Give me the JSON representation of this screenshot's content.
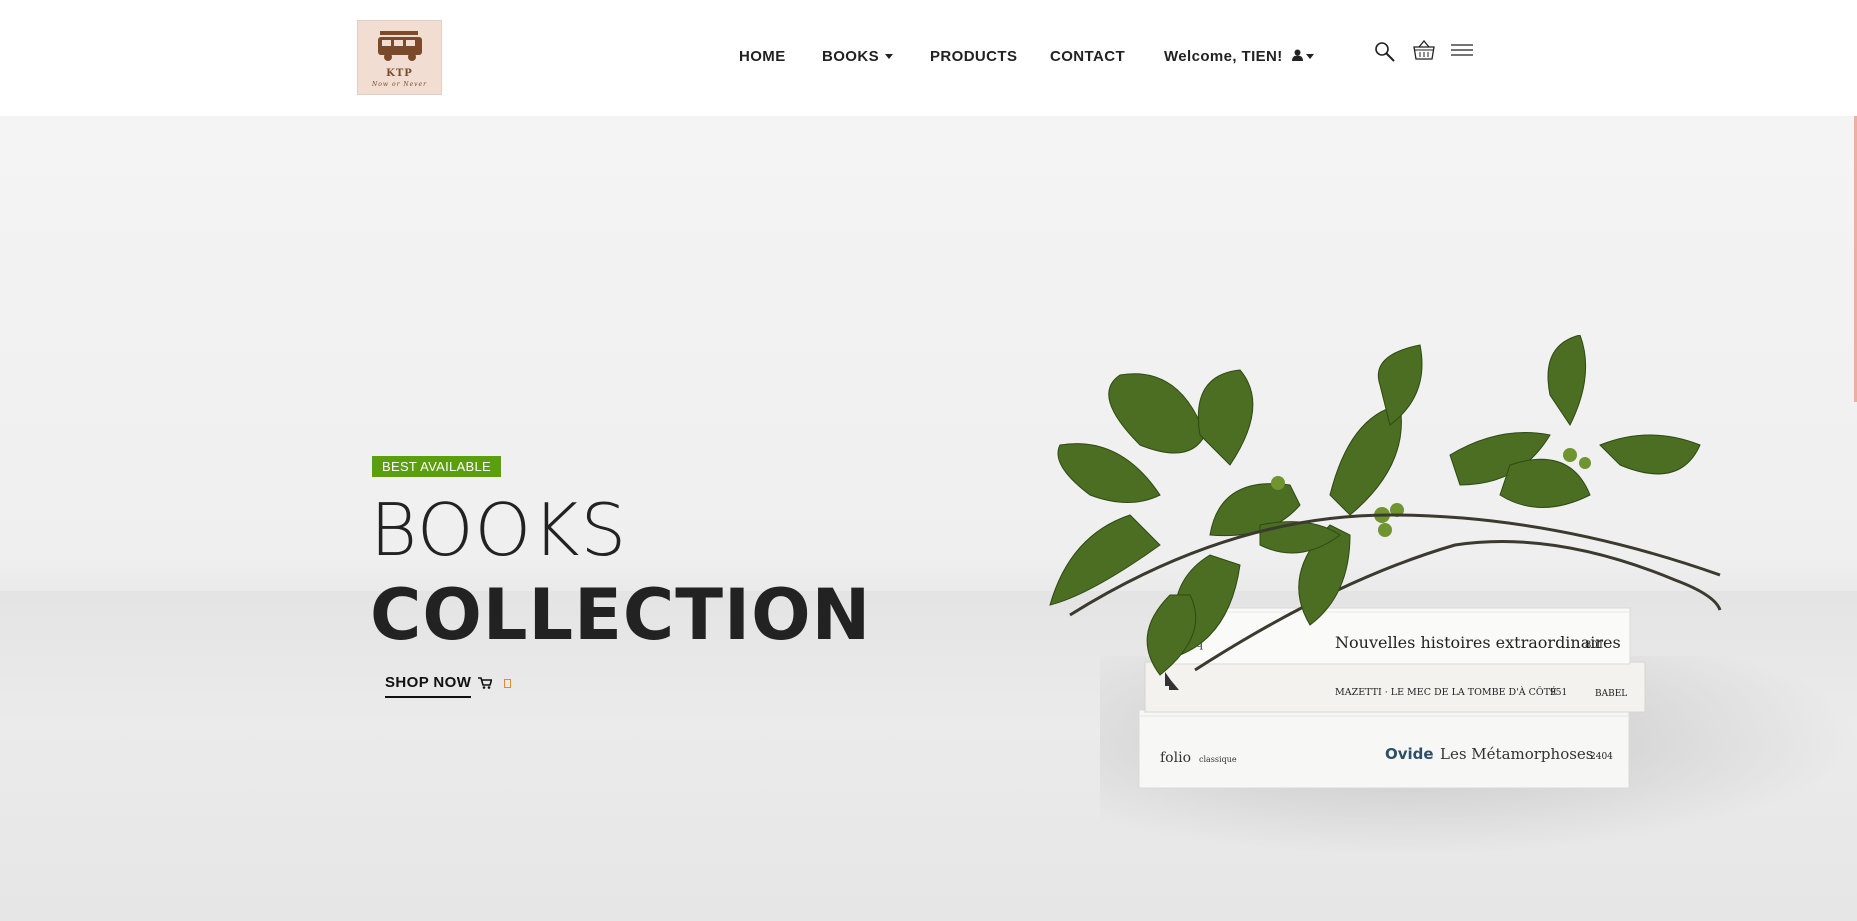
{
  "logo": {
    "line1": "KTP",
    "line2": "Now or Never"
  },
  "nav": {
    "home": "HOME",
    "books": "BOOKS",
    "products": "PRODUCTS",
    "contact": "CONTACT",
    "welcome": "Welcome, TIEN!"
  },
  "icons": [
    "search-icon",
    "basket-icon",
    "menu-icon"
  ],
  "hero": {
    "badge": "BEST AVAILABLE",
    "title_light": "BOOKS",
    "title_bold": "COLLECTION",
    "cta": "SHOP NOW"
  },
  "book_spines": {
    "top": "Nouvelles histoires extraordinaires",
    "top_publisher": "classiq",
    "top_number": "801",
    "middle": "MAZETTI · LE MEC DE LA TOMBE D'À CÔTÉ",
    "middle_number": "951",
    "middle_publisher": "BABEL",
    "bottom_publisher": "folio",
    "bottom_publisher_sub": "classique",
    "bottom_author": "Ovide",
    "bottom_title": "Les Métamorphoses",
    "bottom_number": "2404"
  },
  "colors": {
    "badge": "#5b9e0e",
    "text": "#222222",
    "accent_orange": "#e38b2c"
  }
}
